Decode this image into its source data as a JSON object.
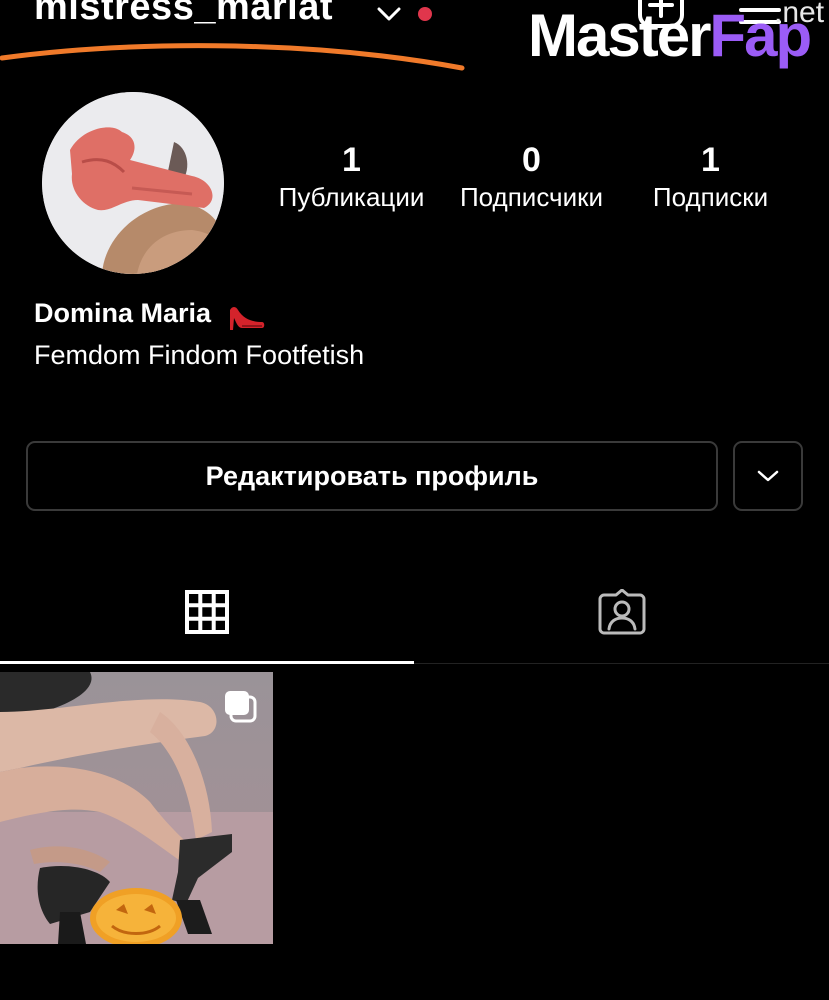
{
  "header": {
    "username": "mistress_mariat"
  },
  "watermark": {
    "part1": "Master",
    "part2": "Fap",
    "suffix": ".net"
  },
  "profile": {
    "display_name": "Domina Maria",
    "bio": "Femdom Findom Footfetish"
  },
  "stats": [
    {
      "value": "1",
      "label": "Публикации"
    },
    {
      "value": "0",
      "label": "Подписчики"
    },
    {
      "value": "1",
      "label": "Подписки"
    }
  ],
  "actions": {
    "edit_profile_label": "Редактировать профиль"
  },
  "tabs": {
    "grid_icon": "grid-icon",
    "tagged_icon": "tagged-person-icon"
  },
  "posts": [
    {
      "kind": "photo",
      "multi": true
    }
  ],
  "colors": {
    "background": "#000000",
    "accent_underline": "#f07a2a",
    "notification_dot": "#e0364c",
    "watermark_accent": "#9b5cf6"
  }
}
